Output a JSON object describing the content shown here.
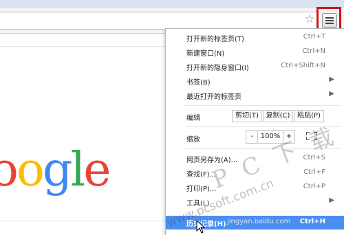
{
  "logo": {
    "text": "oogle",
    "colors": [
      "#ea4335",
      "#fbbc05",
      "#4285f4",
      "#34a853",
      "#ea4335"
    ]
  },
  "icons": {
    "bookmark": "star-icon",
    "menu": "hamburger-menu-icon"
  },
  "accent": {
    "highlight": "#4a8ff0",
    "annotation": "#d41418"
  },
  "menu": {
    "new_tab": {
      "label": "打开新的标签页(T)",
      "shortcut": "Ctrl+T"
    },
    "new_window": {
      "label": "新建窗口(N)",
      "shortcut": "Ctrl+N"
    },
    "incognito": {
      "label": "打开新的隐身窗口(I)",
      "shortcut": "Ctrl+Shift+N"
    },
    "bookmarks": {
      "label": "书签(B)"
    },
    "recent_tabs": {
      "label": "最近打开的标签页"
    },
    "edit": {
      "label": "编辑",
      "cut": "剪切(T)",
      "copy": "复制(C)",
      "paste": "粘贴(P)"
    },
    "zoom": {
      "label": "缩放",
      "minus": "-",
      "value": "100%",
      "plus": "+"
    },
    "save_as": {
      "label": "网页另存为(A)...",
      "shortcut": "Ctrl+S"
    },
    "find": {
      "label": "查找(F)...",
      "shortcut": "Ctrl+F"
    },
    "print": {
      "label": "打印(P)...",
      "shortcut": "Ctrl+P"
    },
    "tools": {
      "label": "工具(L)"
    },
    "history": {
      "label": "历史记录(H)",
      "shortcut": "Ctrl+H"
    }
  },
  "watermark": {
    "brand": "P C 下 载 网",
    "url": "www.pcsoft.com.cn",
    "source": "jingyan.baidu.com"
  }
}
